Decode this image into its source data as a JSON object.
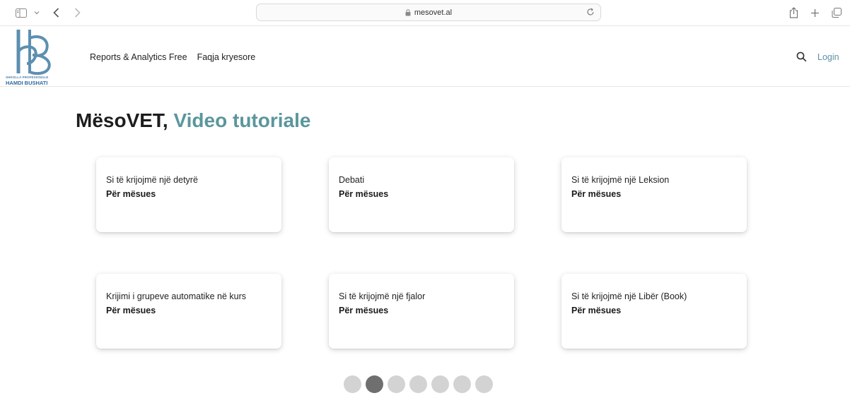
{
  "browser": {
    "url": "mesovet.al"
  },
  "header": {
    "logo_small": "SHKOLLA PROFESIONALE",
    "logo_big": "HAMDI BUSHATI",
    "nav": [
      "Reports & Analytics Free",
      "Faqja kryesore"
    ],
    "login": "Login"
  },
  "main": {
    "title_plain": "MësoVET,",
    "title_accent": "Video tutoriale",
    "cards": [
      {
        "title": "Si të krijojmë një detyrë",
        "subtitle": "Për mësues"
      },
      {
        "title": "Debati",
        "subtitle": "Për mësues"
      },
      {
        "title": "Si të krijojmë një Leksion",
        "subtitle": "Për mësues"
      },
      {
        "title": "Krijimi i grupeve automatike në kurs",
        "subtitle": "Për mësues"
      },
      {
        "title": "Si të krijojmë një fjalor",
        "subtitle": "Për mësues"
      },
      {
        "title": "Si të krijojmë një Libër (Book)",
        "subtitle": "Për mësues"
      }
    ],
    "pagination": {
      "count": 7,
      "active": 2
    }
  },
  "colors": {
    "accent": "#5b969c",
    "login": "#5f8fa6",
    "logo": "#4d7fa8",
    "dot_active": "#6f6f6f",
    "dot_inactive": "#d3d3d3"
  }
}
